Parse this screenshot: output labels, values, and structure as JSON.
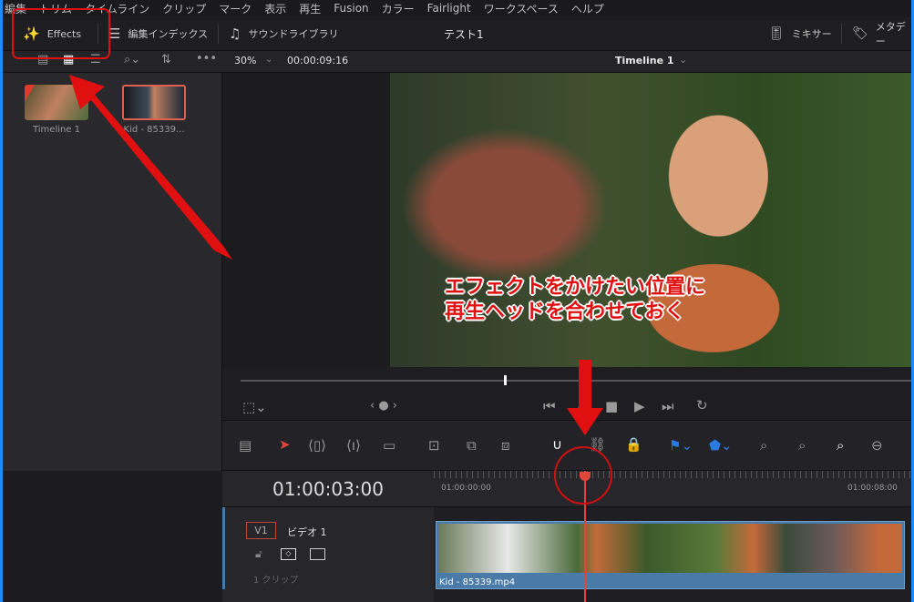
{
  "menu": [
    "編集",
    "トリム",
    "タイムライン",
    "クリップ",
    "マーク",
    "表示",
    "再生",
    "Fusion",
    "カラー",
    "Fairlight",
    "ワークスペース",
    "ヘルプ"
  ],
  "toolbar": {
    "effects": "Effects",
    "edit_index": "編集インデックス",
    "sound_library": "サウンドライブラリ",
    "project_title": "テスト1",
    "mixer": "ミキサー",
    "metadata": "メタデー"
  },
  "viewer": {
    "zoom": "30%",
    "timecode": "00:00:09:16",
    "timeline_name": "Timeline 1"
  },
  "media_pool": [
    {
      "label": "Timeline 1"
    },
    {
      "label": "Kid - 85339..."
    }
  ],
  "timeline": {
    "current_timecode": "01:00:03:00",
    "ruler_start": "01:00:00:00",
    "ruler_mark": "01:00:08:00",
    "track_id": "V1",
    "track_name": "ビデオ 1",
    "clip_count": "1 クリップ",
    "clip_name": "Kid - 85339.mp4"
  },
  "annotation": {
    "line1": "エフェクトをかけたい位置に",
    "line2": "再生ヘッドを合わせておく"
  },
  "colors": {
    "annotation": "#e01010",
    "playhead": "#e0463a",
    "clip": "#4a7aa8",
    "border": "#1a8cff"
  }
}
